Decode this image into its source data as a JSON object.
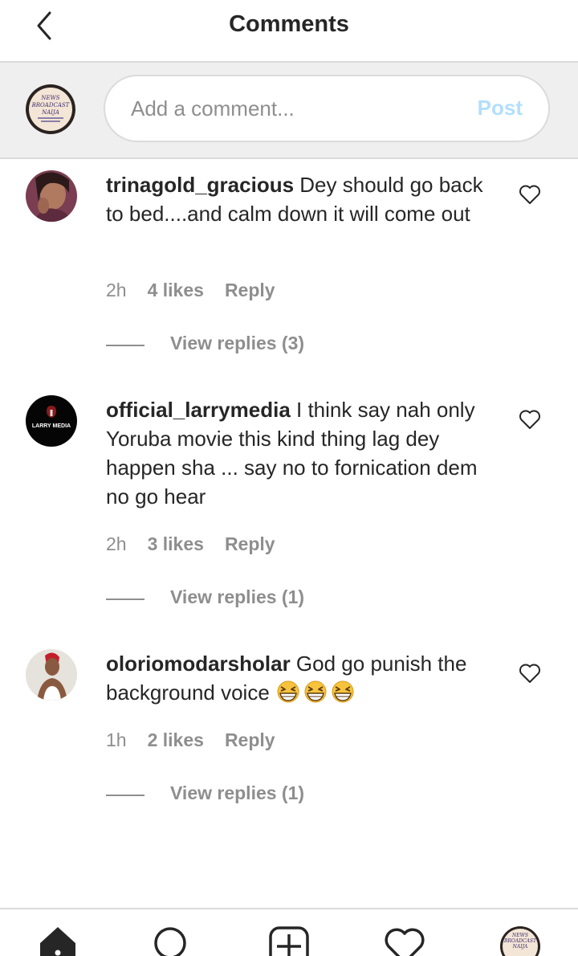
{
  "header": {
    "title": "Comments",
    "back_icon": "chevron-left-icon"
  },
  "composer": {
    "avatar_logo": "NEWS BROADCAST NAIJA",
    "placeholder": "Add a comment...",
    "post_label": "Post",
    "post_color": "#b2dffc"
  },
  "comments": [
    {
      "username": "trinagold_gracious",
      "text": " Dey should go back to bed....and calm down it will come out",
      "time": "2h",
      "likes": "4 likes",
      "reply": "Reply",
      "view_replies": "View replies (3)"
    },
    {
      "username": "official_larrymedia",
      "avatar_logo": "LARRY MEDIA",
      "text": " I think say nah only Yoruba movie this kind thing lag dey happen sha ... say no to fornication dem no go hear",
      "time": "2h",
      "likes": "3 likes",
      "reply": "Reply",
      "view_replies": "View replies (1)"
    },
    {
      "username": "oloriomodarsholar",
      "text": " God go punish the background voice ",
      "emojis": [
        "grinning-squinting-face",
        "grinning-squinting-face",
        "grinning-squinting-face"
      ],
      "time": "1h",
      "likes": "2 likes",
      "reply": "Reply",
      "view_replies": "View replies (1)"
    }
  ],
  "bottom_nav": {
    "items": [
      "home-icon",
      "search-icon",
      "add-post-icon",
      "activity-heart-icon",
      "profile-avatar"
    ],
    "profile_logo": "NEWS BROADCAST NAIJA"
  },
  "colors": {
    "text": "#262626",
    "secondary": "#8e8e8e",
    "divider": "#dbdbdb",
    "composer_bg": "#efefef"
  }
}
